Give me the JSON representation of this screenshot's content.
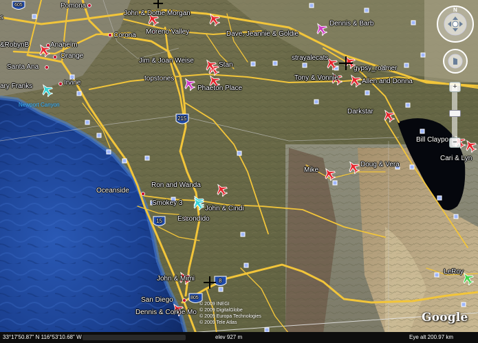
{
  "colors": {
    "ocean": "#1a3f8f",
    "land": "#6b6a47",
    "road": "#f2c53a",
    "placemark_red": "#e8272f",
    "placemark_cyan": "#36d4d8",
    "placemark_magenta": "#d23cc8",
    "water_label": "#3fb8ff",
    "lake": "#06080f"
  },
  "placemarks": [
    {
      "label": "John & Dottie Morgan",
      "icon": "red-airplane-placemark-icon"
    },
    {
      "label": "Dave, Jeannie & Goldie",
      "icon": "red-airplane-placemark-icon"
    },
    {
      "label": "Dennis & Barb",
      "icon": "magenta-airplane-placemark-icon"
    },
    {
      "label": "&RobynB",
      "icon": "red-airplane-placemark-icon"
    },
    {
      "label": "strayalecats",
      "icon": "red-airplane-placemark-icon"
    },
    {
      "label": "gypsy_roamer",
      "icon": "red-airplane-placemark-icon"
    },
    {
      "label": "Jim & Joan Weise",
      "icon": "red-airplane-placemark-icon"
    },
    {
      "label": "Stan",
      "icon": "red-airplane-placemark-icon"
    },
    {
      "label": "topstones",
      "icon": "magenta-airplane-placemark-icon"
    },
    {
      "label": "Phaeton Place",
      "icon": "red-airplane-placemark-icon"
    },
    {
      "label": "Tony & Vonnie",
      "icon": "red-airplane-placemark-icon"
    },
    {
      "label": "Allen and Donna",
      "icon": "red-airplane-placemark-icon"
    },
    {
      "label": "ary Franks",
      "icon": "cyan-airplane-placemark-icon"
    },
    {
      "label": "Darkstar",
      "icon": "red-airplane-placemark-icon"
    },
    {
      "label": "Bill Claypo",
      "icon": "red-airplane-placemark-icon"
    },
    {
      "label": "Cari & Lyn",
      "icon": "red-airplane-placemark-icon"
    },
    {
      "label": "Mike",
      "icon": "red-airplane-placemark-icon"
    },
    {
      "label": "Doug & Vera",
      "icon": "red-airplane-placemark-icon"
    },
    {
      "label": "Ron and Wanda",
      "icon": "red-airplane-placemark-icon"
    },
    {
      "label": "Smokey 3",
      "icon": "cyan-airplane-placemark-icon"
    },
    {
      "label": "John & Cindi",
      "icon": "cyan-airplane-placemark-icon"
    },
    {
      "label": "John & Mimi",
      "icon": "red-airplane-placemark-icon"
    },
    {
      "label": "Dennis & Corkie Mo",
      "icon": "red-airplane-placemark-icon"
    },
    {
      "label": "LeRoy",
      "icon": "green-airplane-placemark-icon"
    }
  ],
  "places": {
    "pomona": "Pomona",
    "corona": "Corona",
    "moreno_valley": "Moreno Valley",
    "anaheim": "Anaheim",
    "orange": "Orange",
    "santa_ana": "Santa Ana",
    "irvine": "Irvine",
    "oceanside": "Oceanside",
    "escondido": "Escondido",
    "san_diego": "San Diego",
    "s_edge_top": "s"
  },
  "water_labels": {
    "newport_canyon": "Newport Canyon"
  },
  "shields": {
    "i215": "215",
    "i15": "15",
    "i8": "8",
    "i805": "805",
    "i605": "605"
  },
  "copyright": [
    "© 2009 INEGI",
    "© 2009 DigitalGlobe",
    "© 2009 Europa Technologies",
    "© 2009 Tele Atlas"
  ],
  "google_logo": "Google",
  "status": {
    "coords": "33°17'50.87\" N   116°53'10.68\" W",
    "elev": "elev  927 m",
    "eye_alt": "Eye alt   200.97 km"
  }
}
